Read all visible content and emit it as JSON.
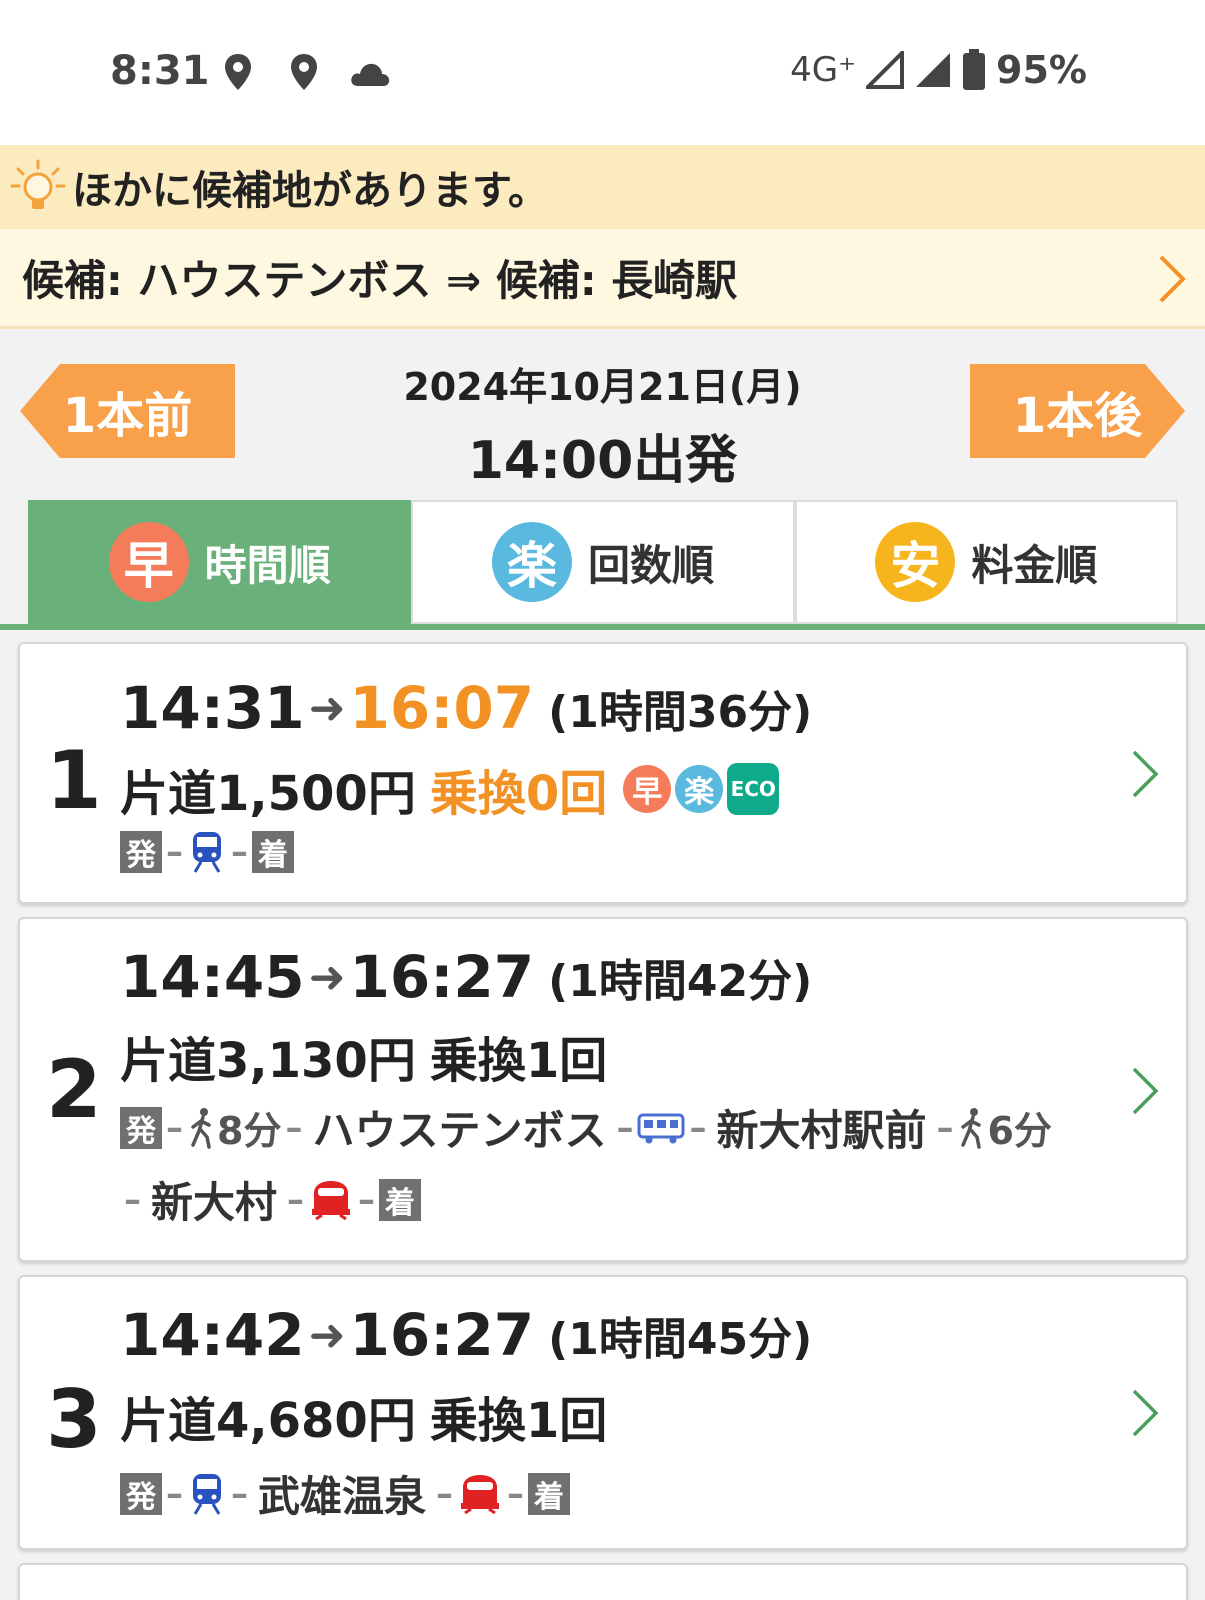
{
  "status_bar": {
    "time": "8:31",
    "network": "4G⁺",
    "battery": "95%"
  },
  "notice": {
    "text": "ほかに候補地があります。"
  },
  "candidate": {
    "text": "候補: ハウステンボス ⇒ 候補: 長崎駅"
  },
  "nav": {
    "prev_label": "1本前",
    "next_label": "1本後",
    "date": "2024年10月21日(月)",
    "departure": "14:00出発"
  },
  "tabs": [
    {
      "badge": "早",
      "label": "時間順",
      "color": "#f47c5a",
      "active": true
    },
    {
      "badge": "楽",
      "label": "回数順",
      "color": "#5ab9de",
      "active": false
    },
    {
      "badge": "安",
      "label": "料金順",
      "color": "#f6b51c",
      "active": false
    }
  ],
  "routes": [
    {
      "rank": "1",
      "depart": "14:31",
      "arrow": "➜",
      "arrive": "16:07",
      "duration": "(1時間36分)",
      "fare": "片道1,500円",
      "transfers": "乗換0回",
      "badges": {
        "fast": "早",
        "easy": "楽",
        "eco": "ECO"
      },
      "legs": {
        "start": "発",
        "end": "着"
      }
    },
    {
      "rank": "2",
      "depart": "14:45",
      "arrow": "➜",
      "arrive": "16:27",
      "duration": "(1時間42分)",
      "fare": "片道3,130円",
      "transfers": "乗換1回",
      "legs": {
        "start": "発",
        "walk1": "8分",
        "station1": "ハウステンボス",
        "station2": "新大村駅前",
        "walk2": "6分",
        "station3": "新大村",
        "end": "着"
      }
    },
    {
      "rank": "3",
      "depart": "14:42",
      "arrow": "➜",
      "arrive": "16:27",
      "duration": "(1時間45分)",
      "fare": "片道4,680円",
      "transfers": "乗換1回",
      "legs": {
        "start": "発",
        "station1": "武雄温泉",
        "end": "着"
      }
    }
  ],
  "colors": {
    "accent_green": "#6ab07a",
    "orange": "#f39224",
    "nav_orange": "#f9a04a",
    "banner": "#fdebc0"
  }
}
